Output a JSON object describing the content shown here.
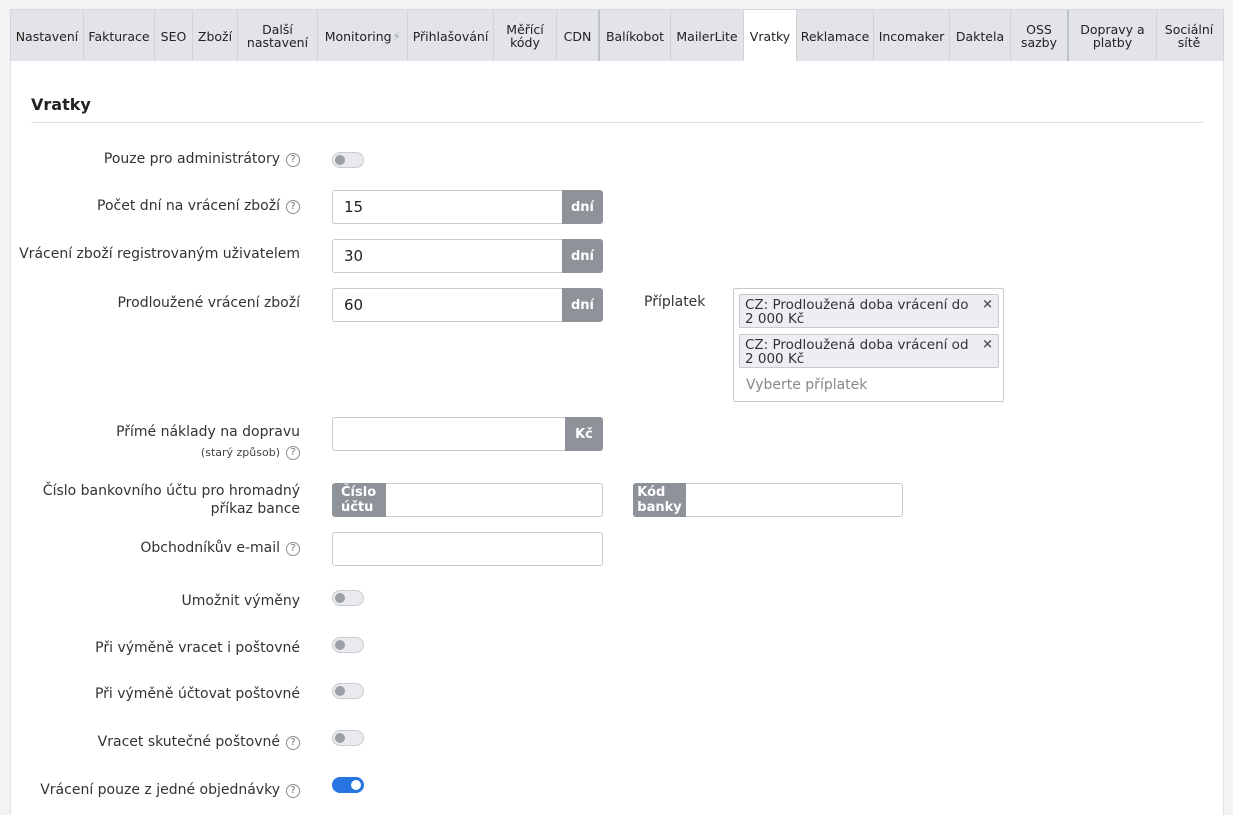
{
  "tabs": [
    {
      "label": "Nastavení"
    },
    {
      "label": "Fakturace"
    },
    {
      "label": "SEO"
    },
    {
      "label": "Zboží"
    },
    {
      "label": "Další nastavení"
    },
    {
      "label": "Monitoring",
      "icon": "bolt-icon"
    },
    {
      "label": "Přihlašování"
    },
    {
      "label": "Měřící kódy"
    },
    {
      "label": "CDN"
    },
    {
      "label": "Balíkobot"
    },
    {
      "label": "MailerLite"
    },
    {
      "label": "Vratky",
      "active": true
    },
    {
      "label": "Reklamace"
    },
    {
      "label": "Incomaker"
    },
    {
      "label": "Daktela"
    },
    {
      "label": "OSS sazby"
    },
    {
      "label": "Dopravy a platby"
    },
    {
      "label": "Sociální sítě"
    }
  ],
  "section": {
    "title": "Vratky"
  },
  "help_glyph": "?",
  "fields": {
    "admin_only": {
      "label": "Pouze pro administrátory",
      "enabled": false
    },
    "return_days": {
      "label": "Počet dní na vrácení zboží",
      "value": "15",
      "unit": "dní"
    },
    "registered_days": {
      "label": "Vrácení zboží registrovaným uživatelem",
      "value": "30",
      "unit": "dní"
    },
    "extended_days": {
      "label": "Prodloužené vrácení zboží",
      "value": "60",
      "unit": "dní"
    },
    "surcharge": {
      "label": "Příplatek",
      "selected": [
        "CZ: Prodloužená doba vrácení do 2 000 Kč",
        "CZ: Prodloužená doba vrácení od 2 000 Kč"
      ],
      "remove_glyph": "×",
      "placeholder": "Vyberte příplatek"
    },
    "shipping_costs": {
      "label": "Přímé náklady na dopravu",
      "sublabel": "(starý způsob)",
      "value": "",
      "unit": "Kč"
    },
    "bank_account": {
      "label_line1": "Číslo bankovního účtu pro hromadný",
      "label_line2": "příkaz bance",
      "account_addon": "Číslo účtu",
      "bank_code_addon": "Kód banky",
      "account_value": "",
      "bank_code_value": ""
    },
    "merchant_email": {
      "label": "Obchodníkův e-mail",
      "value": ""
    },
    "allow_exchange": {
      "label": "Umožnit výměny",
      "enabled": false
    },
    "exchange_refund_shipping": {
      "label": "Při výměně vracet i poštovné",
      "enabled": false
    },
    "exchange_charge_shipping": {
      "label": "Při výměně účtovat poštovné",
      "enabled": false
    },
    "actual_shipping": {
      "label": "Vracet skutečné poštovné",
      "enabled": false
    },
    "single_order_only": {
      "label": "Vrácení pouze z jedné objednávky",
      "enabled": true
    }
  }
}
